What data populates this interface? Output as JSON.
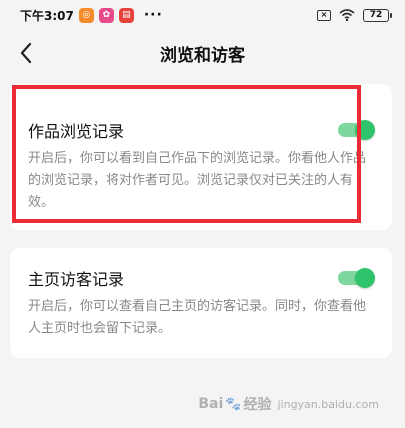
{
  "status_bar": {
    "time": "下午3:07",
    "app_icons": [
      {
        "name": "app-icon-1",
        "color": "#f58a2a",
        "glyph": "◎"
      },
      {
        "name": "app-icon-2",
        "color": "#e64a8a",
        "glyph": "✿"
      },
      {
        "name": "app-icon-3",
        "color": "#e8423c",
        "glyph": "▤"
      }
    ],
    "more": "···",
    "sim_label": "×",
    "battery": "72"
  },
  "nav": {
    "title": "浏览和访客"
  },
  "settings": {
    "browse_record": {
      "title": "作品浏览记录",
      "description": "开启后，你可以看到自己作品下的浏览记录。你看他人作品的浏览记录，将对作者可见。浏览记录仅对已关注的人有效。",
      "enabled": true
    },
    "visitor_record": {
      "title": "主页访客记录",
      "description": "开启后，你可以查看自己主页的访客记录。同时，你查看他人主页时也会留下记录。",
      "enabled": true
    }
  },
  "watermark": {
    "text_left": "Bai",
    "text_right": "经验",
    "sub": "jingyan.baidu.com"
  },
  "colors": {
    "toggle_on": "#2fc46b",
    "highlight": "#ec2b36"
  }
}
